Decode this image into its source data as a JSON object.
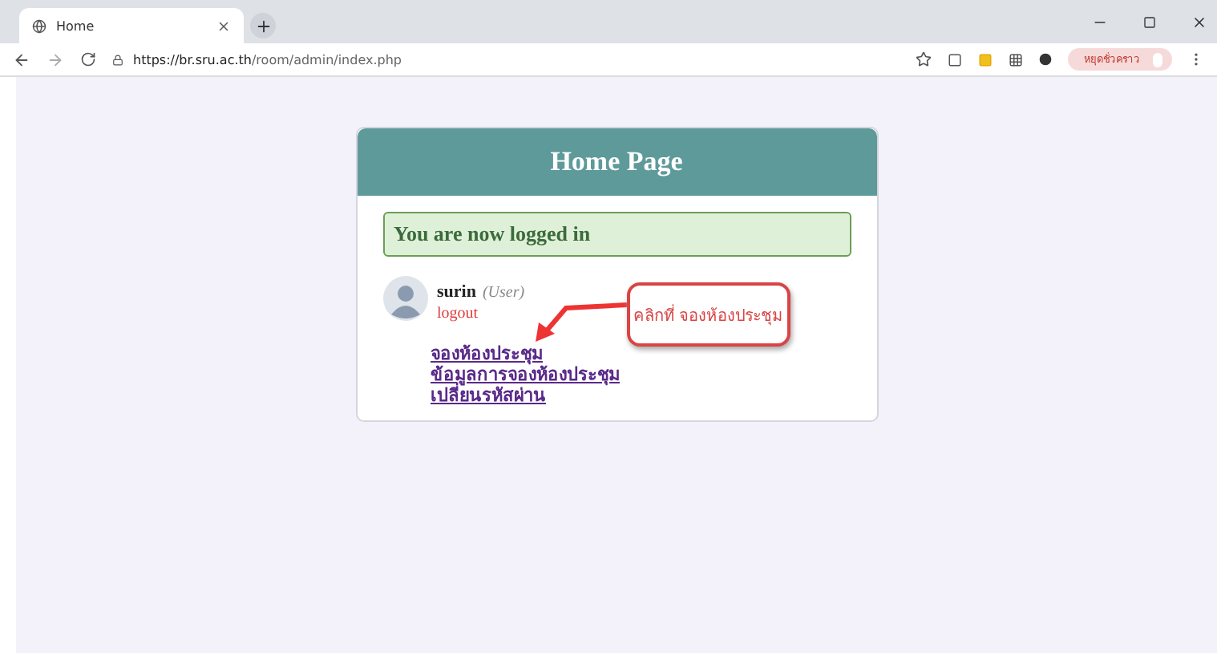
{
  "browser": {
    "tab": {
      "title": "Home",
      "selected": true
    },
    "url": {
      "host": "https://br.sru.ac.th",
      "path": "/room/admin/index.php"
    },
    "profile": {
      "label": "หยุดชั่วคราว"
    }
  },
  "card": {
    "title": "Home Page",
    "alert": "You are now logged in",
    "user": {
      "name": "surin",
      "role": "(User)",
      "logout": "logout"
    },
    "links": [
      {
        "label": "จองห้องประชุม"
      },
      {
        "label": "ข้อมูลการจองห้องประชุม"
      },
      {
        "label": "เปลี่ยนรหัสผ่าน"
      }
    ],
    "callout": "คลิกที่  จองห้องประชุม"
  }
}
